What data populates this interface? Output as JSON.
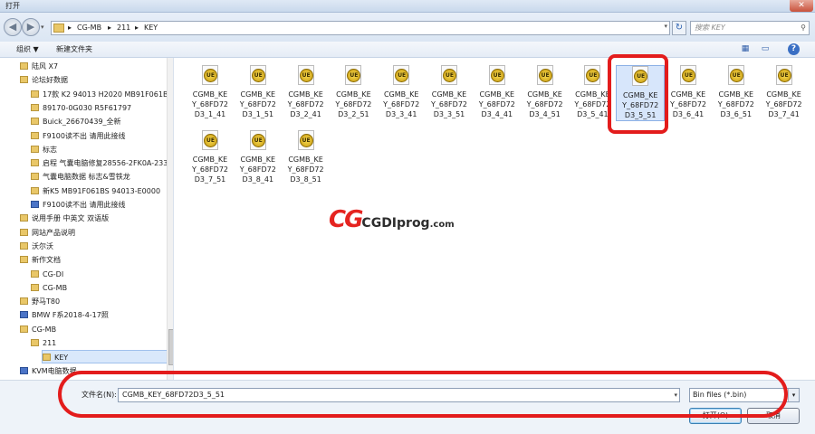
{
  "window": {
    "title": "打开",
    "close": "✕"
  },
  "address": {
    "crumbs": [
      "CG-MB",
      "211",
      "KEY"
    ],
    "search_placeholder": "搜索 KEY"
  },
  "toolbar": {
    "organize": "组织 ▼",
    "new_folder": "新建文件夹"
  },
  "sidebar": {
    "items": [
      {
        "label": "陆风 X7",
        "indent": 1
      },
      {
        "label": "论坛好数据",
        "indent": 1
      },
      {
        "label": "17款 K2  94013 H2020 MB91F061BS",
        "indent": 2
      },
      {
        "label": "89170-0G030    R5F61797",
        "indent": 2
      },
      {
        "label": "Buick_26670439_全新",
        "indent": 2
      },
      {
        "label": "F9100读不出 请用此接线",
        "indent": 2
      },
      {
        "label": "标志",
        "indent": 2
      },
      {
        "label": "启程  气囊电脑修复28556-2FK0A-2336",
        "indent": 2
      },
      {
        "label": "气囊电脑数据  标志&雪铁龙",
        "indent": 2
      },
      {
        "label": "新K5    MB91F061BS   94013-E0000",
        "indent": 2
      },
      {
        "label": "F9100读不出 请用此接线",
        "indent": 2,
        "blue": true
      },
      {
        "label": "说用手册 中英文 双语版",
        "indent": 1
      },
      {
        "label": "网站产品说明",
        "indent": 1
      },
      {
        "label": "沃尔沃",
        "indent": 1
      },
      {
        "label": "新作文档",
        "indent": 1
      },
      {
        "label": "CG-DI",
        "indent": 2
      },
      {
        "label": "CG-MB",
        "indent": 2
      },
      {
        "label": "野马T80",
        "indent": 1
      },
      {
        "label": "BMW F系2018-4-17照",
        "indent": 1,
        "blue": true
      },
      {
        "label": "CG-MB",
        "indent": 1
      },
      {
        "label": "211",
        "indent": 2
      },
      {
        "label": "KEY",
        "indent": 3,
        "selected": true
      },
      {
        "label": "KVM电脑数据",
        "indent": 1,
        "blue": true
      }
    ]
  },
  "files": [
    {
      "line1": "CGMB_KE",
      "line2": "Y_68FD72",
      "line3": "D3_1_41"
    },
    {
      "line1": "CGMB_KE",
      "line2": "Y_68FD72",
      "line3": "D3_1_51"
    },
    {
      "line1": "CGMB_KE",
      "line2": "Y_68FD72",
      "line3": "D3_2_41"
    },
    {
      "line1": "CGMB_KE",
      "line2": "Y_68FD72",
      "line3": "D3_2_51"
    },
    {
      "line1": "CGMB_KE",
      "line2": "Y_68FD72",
      "line3": "D3_3_41"
    },
    {
      "line1": "CGMB_KE",
      "line2": "Y_68FD72",
      "line3": "D3_3_51"
    },
    {
      "line1": "CGMB_KE",
      "line2": "Y_68FD72",
      "line3": "D3_4_41"
    },
    {
      "line1": "CGMB_KE",
      "line2": "Y_68FD72",
      "line3": "D3_4_51"
    },
    {
      "line1": "CGMB_KE",
      "line2": "Y_68FD72",
      "line3": "D3_5_41"
    },
    {
      "line1": "CGMB_KE",
      "line2": "Y_68FD72",
      "line3": "D3_5_51",
      "selected": true
    },
    {
      "line1": "CGMB_KE",
      "line2": "Y_68FD72",
      "line3": "D3_6_41"
    },
    {
      "line1": "CGMB_KE",
      "line2": "Y_68FD72",
      "line3": "D3_6_51"
    },
    {
      "line1": "CGMB_KE",
      "line2": "Y_68FD72",
      "line3": "D3_7_41"
    },
    {
      "line1": "CGMB_KE",
      "line2": "Y_68FD72",
      "line3": "D3_7_51"
    },
    {
      "line1": "CGMB_KE",
      "line2": "Y_68FD72",
      "line3": "D3_8_41"
    },
    {
      "line1": "CGMB_KE",
      "line2": "Y_68FD72",
      "line3": "D3_8_51"
    }
  ],
  "watermark": {
    "logo": "CG",
    "brand": "CGDIprog",
    "domain": ".com"
  },
  "bottom": {
    "filename_label": "文件名(N):",
    "filename_value": "CGMB_KEY_68FD72D3_5_51",
    "filetype": "Bin files (*.bin)",
    "open_label": "打开(O)",
    "cancel_label": "取消"
  },
  "colors": {
    "highlight": "#e31c1c",
    "selection": "#d7e6fb",
    "brand_red": "#e52420"
  }
}
